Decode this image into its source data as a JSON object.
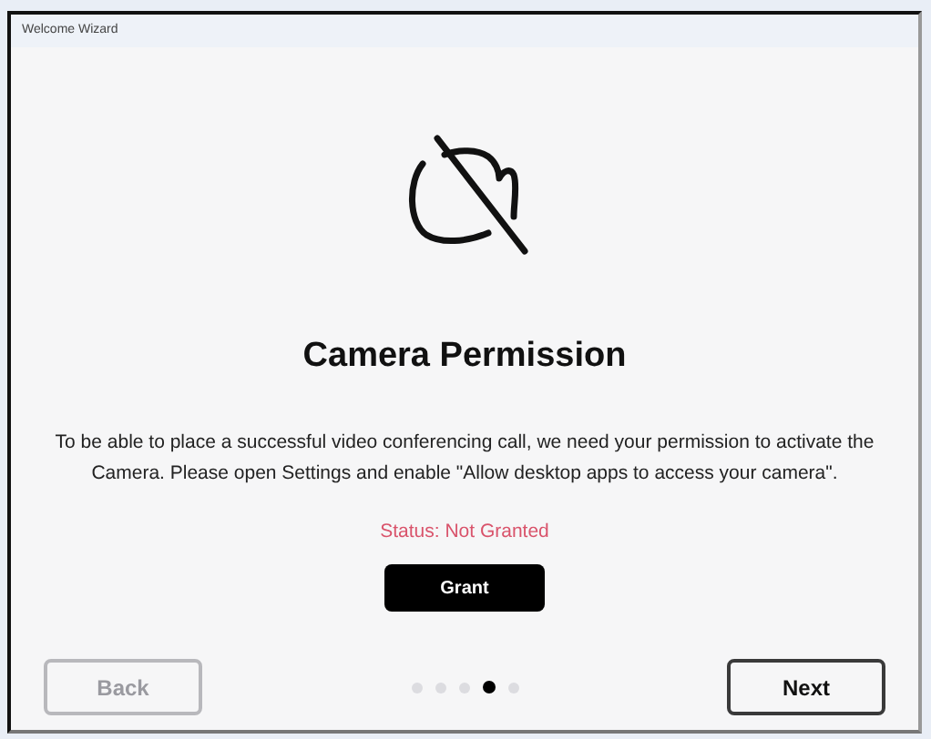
{
  "window": {
    "title": "Welcome Wizard"
  },
  "heading": "Camera Permission",
  "description": "To be able to place a successful video conferencing call, we need your permission to activate the Camera. Please open Settings and enable \"Allow desktop apps to access your camera\".",
  "status": "Status: Not Granted",
  "grant_button": "Grant",
  "back_button": {
    "label": "Back",
    "disabled": true
  },
  "next_button": {
    "label": "Next",
    "disabled": false
  },
  "steps": [
    {
      "selected": false
    },
    {
      "selected": false
    },
    {
      "selected": false
    },
    {
      "selected": true
    },
    {
      "selected": false
    }
  ]
}
